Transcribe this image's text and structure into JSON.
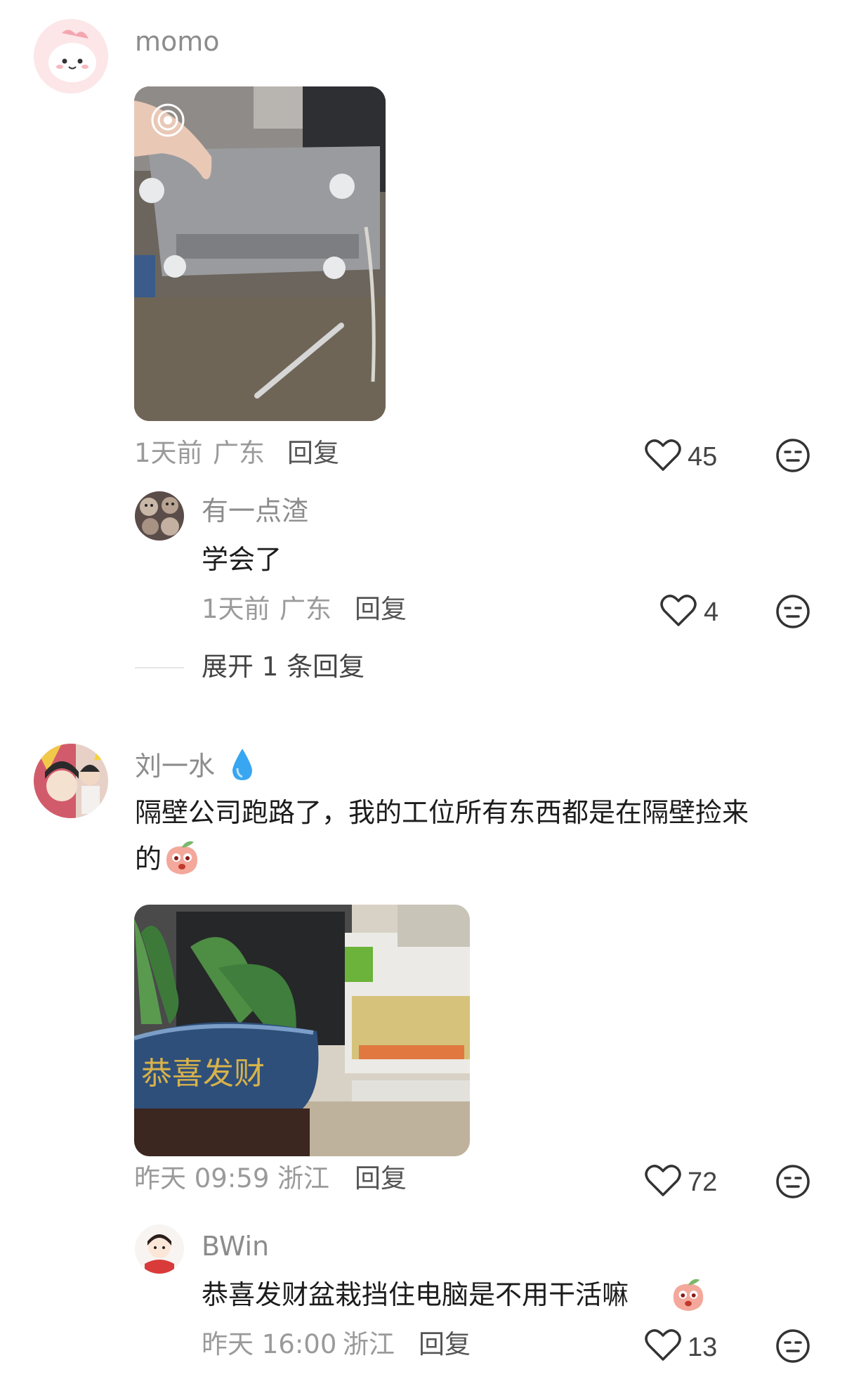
{
  "comments": [
    {
      "user": "momo",
      "time": "1天前",
      "location": "广东",
      "reply_label": "回复",
      "likes": "45",
      "photo": "laptop-on-desk",
      "sub_comments": [
        {
          "user": "有一点渣",
          "text": "学会了",
          "time": "1天前",
          "location": "广东",
          "reply_label": "回复",
          "likes": "4"
        }
      ],
      "expand_label": "展开 1 条回复"
    },
    {
      "user": "刘一水",
      "user_badge": "water-drop-icon",
      "text_line1": "隔壁公司跑路了，我的工位所有东西都是在隔壁捡来",
      "text_line2": "的",
      "time": "昨天 09:59",
      "location": "浙江",
      "reply_label": "回复",
      "likes": "72",
      "photo": "potted-plant-on-desk",
      "photo_text": "恭喜发财",
      "sub_comments": [
        {
          "user": "BWin",
          "text": "恭喜发财盆栽挡住电脑是不用干活嘛",
          "time": "昨天 16:00",
          "location": "浙江",
          "reply_label": "回复",
          "likes": "13"
        }
      ]
    }
  ],
  "colors": {
    "name": "#8c8c8c",
    "text": "#1c1c1c",
    "meta": "#9a9a9a",
    "accent_drop": "#38a6f0"
  }
}
